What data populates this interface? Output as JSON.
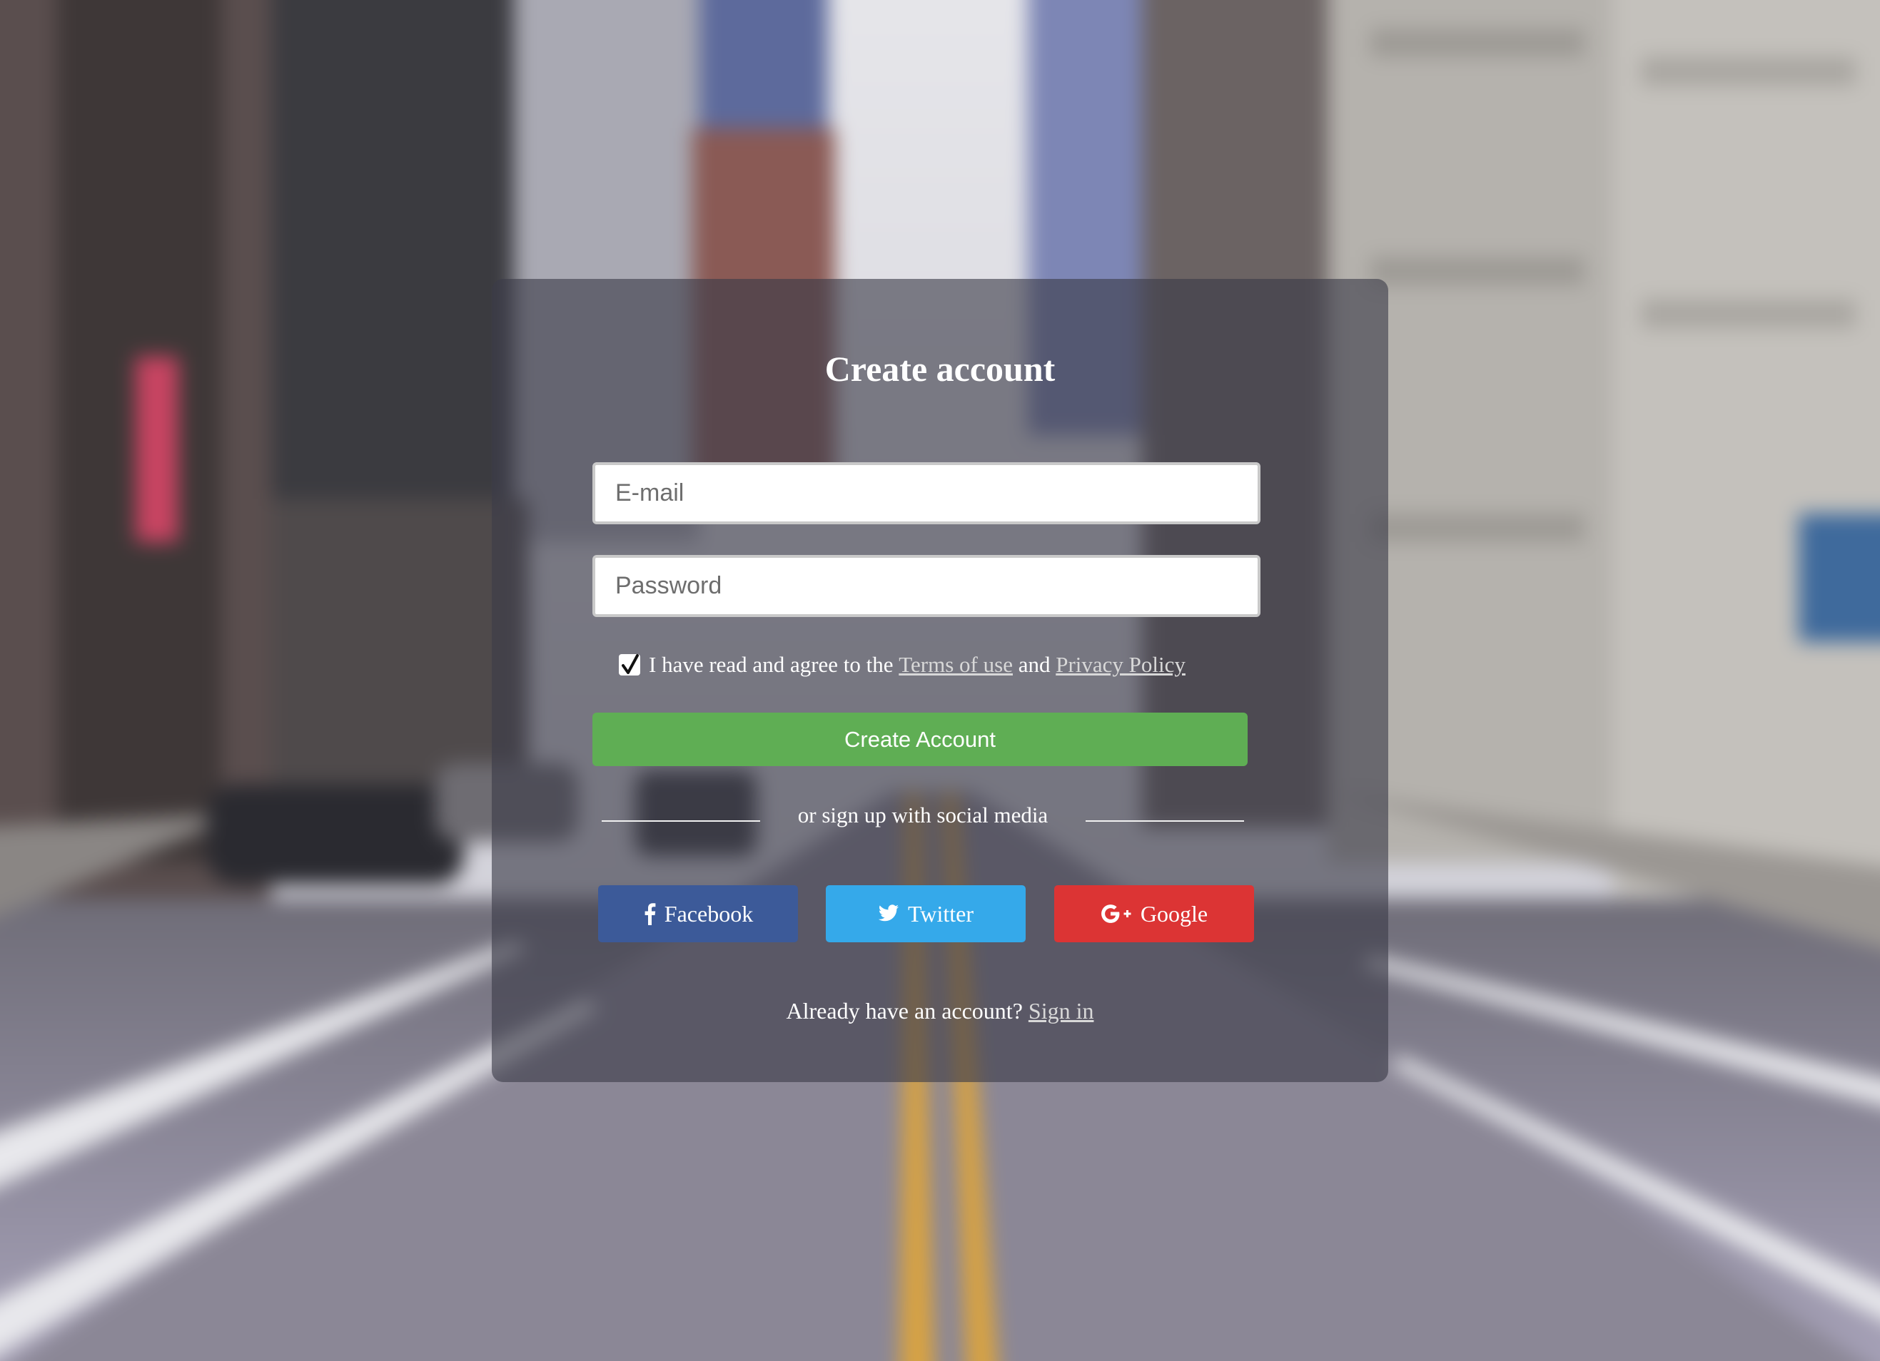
{
  "form": {
    "title": "Create account",
    "email_placeholder": "E-mail",
    "password_placeholder": "Password",
    "agree": {
      "checked": true,
      "prefix": "I have read and agree to the",
      "terms_link": "Terms of use",
      "conjunction": "and",
      "privacy_link": "Privacy Policy"
    },
    "submit_label": "Create Account",
    "divider_text": "or sign up with social media",
    "social": [
      {
        "label": "Facebook",
        "icon": "facebook-icon",
        "color": "#3c5a99"
      },
      {
        "label": "Twitter",
        "icon": "twitter-icon",
        "color": "#35a9ea"
      },
      {
        "label": "Google",
        "icon": "google-plus-icon",
        "color": "#dc3434"
      }
    ],
    "signin_prompt": "Already have an account?",
    "signin_link": "Sign in"
  },
  "colors": {
    "accent_green": "#5fae54",
    "card_overlay": "rgba(60, 60, 72, 0.62)"
  }
}
